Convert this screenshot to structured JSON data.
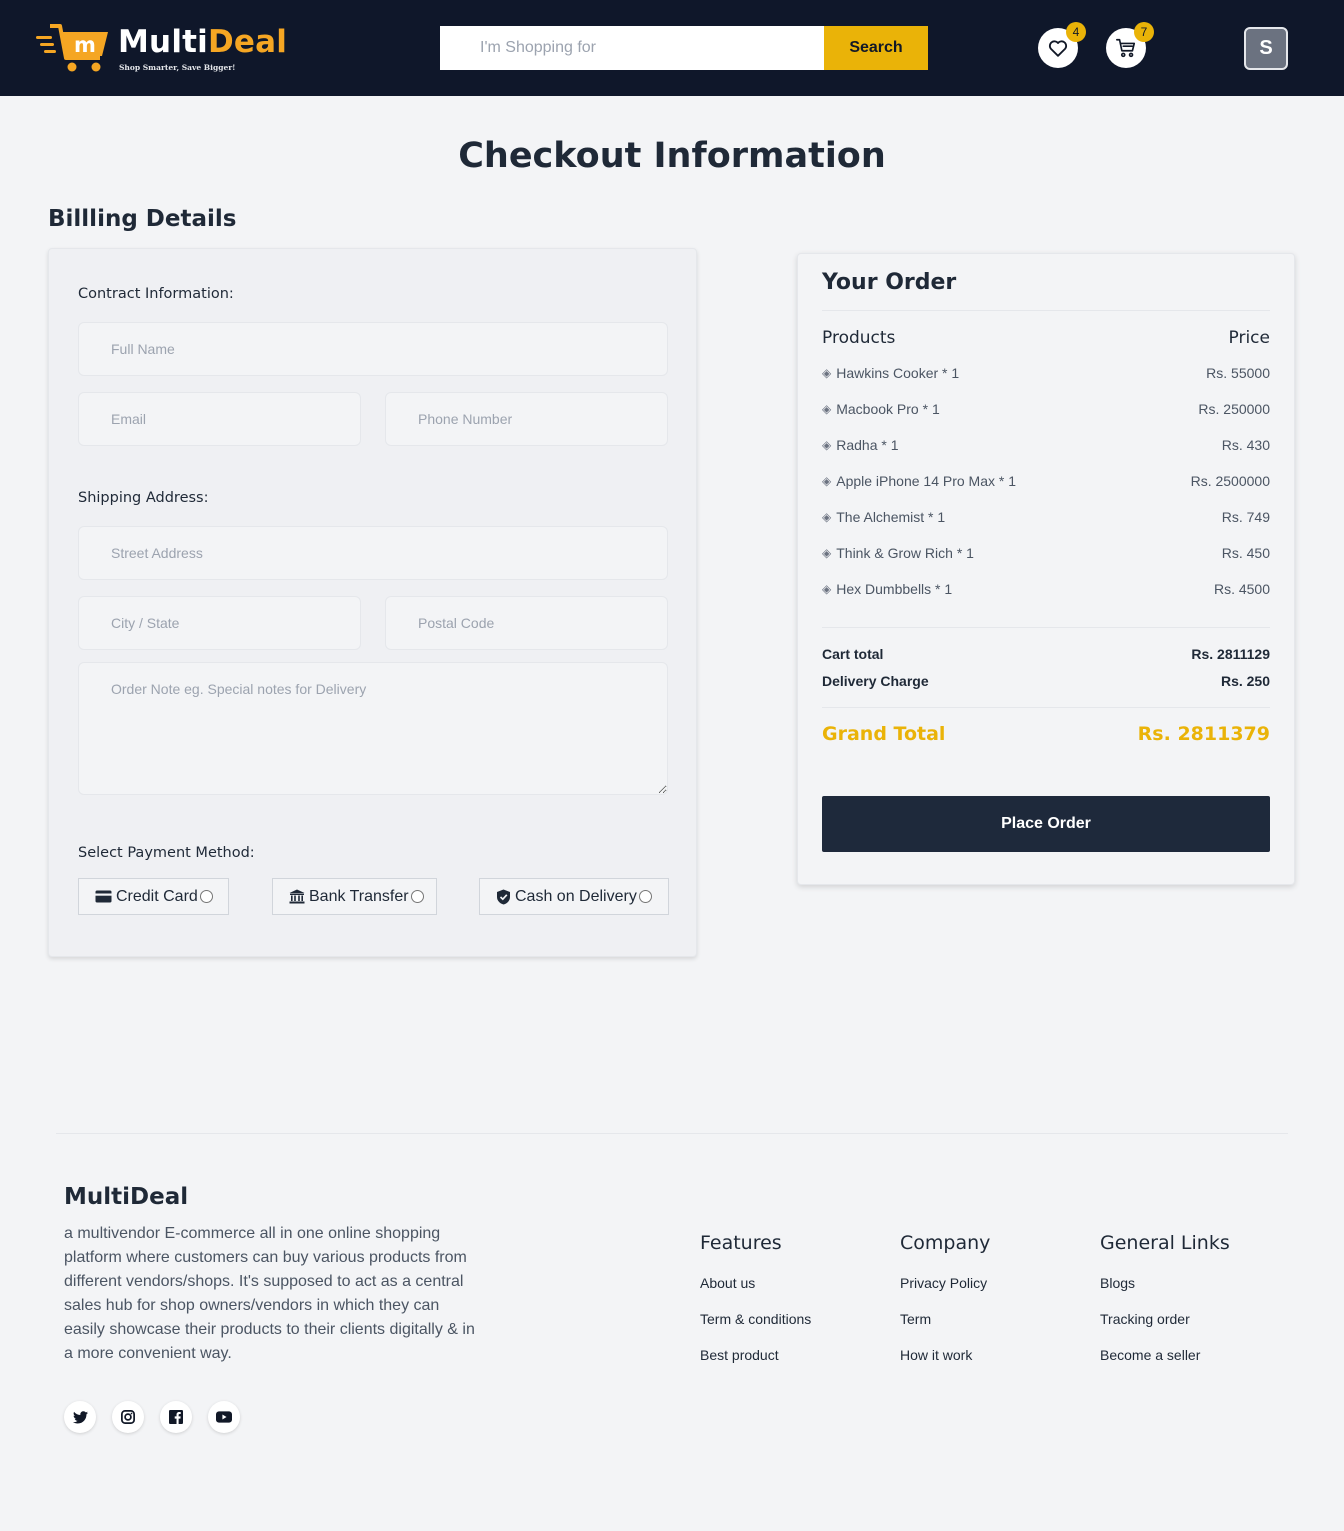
{
  "header": {
    "logo_part1": "Multi",
    "logo_part2": "Deal",
    "logo_tagline": "Shop Smarter, Save Bigger!",
    "search_placeholder": "I'm Shopping for",
    "search_button": "Search",
    "wishlist_count": "4",
    "cart_count": "7",
    "avatar_initial": "S",
    "colors": {
      "bar": "#0f172a",
      "accent": "#eab308",
      "logo_orange": "#f5a623"
    }
  },
  "page": {
    "title": "Checkout Information",
    "billing_title": "Billling Details"
  },
  "billing": {
    "contact_label": "Contract Information:",
    "full_name_placeholder": "Full Name",
    "email_placeholder": "Email",
    "phone_placeholder": "Phone Number",
    "shipping_label": "Shipping Address:",
    "street_placeholder": "Street Address",
    "city_placeholder": "City / State",
    "postal_placeholder": "Postal Code",
    "note_placeholder": "Order Note eg. Special notes for Delivery",
    "payment_label": "Select Payment Method:",
    "payment_options": [
      {
        "label": "Credit Card",
        "icon": "credit-card-icon"
      },
      {
        "label": "Bank Transfer",
        "icon": "bank-icon"
      },
      {
        "label": "Cash on Delivery",
        "icon": "shield-check-icon"
      }
    ]
  },
  "order": {
    "title": "Your Order",
    "products_header": "Products",
    "price_header": "Price",
    "items": [
      {
        "name": "Hawkins Cooker * 1",
        "price": "Rs. 55000"
      },
      {
        "name": "Macbook Pro * 1",
        "price": "Rs. 250000"
      },
      {
        "name": "Radha * 1",
        "price": "Rs. 430"
      },
      {
        "name": "Apple iPhone 14 Pro Max * 1",
        "price": "Rs. 2500000"
      },
      {
        "name": "The Alchemist * 1",
        "price": "Rs. 749"
      },
      {
        "name": "Think & Grow Rich * 1",
        "price": "Rs. 450"
      },
      {
        "name": "Hex Dumbbells * 1",
        "price": "Rs. 4500"
      }
    ],
    "cart_total_label": "Cart total",
    "cart_total": "Rs. 2811129",
    "delivery_label": "Delivery Charge",
    "delivery": "Rs. 250",
    "grand_total_label": "Grand Total",
    "grand_total": "Rs. 2811379",
    "place_order": "Place Order"
  },
  "footer": {
    "brand": "MultiDeal",
    "description": "a multivendor E-commerce all in one online shopping platform where customers can buy various products from different vendors/shops. It's supposed to act as a central sales hub for shop owners/vendors in which they can easily showcase their products to their clients digitally & in a more convenient way.",
    "social": [
      "twitter-icon",
      "instagram-icon",
      "facebook-icon",
      "youtube-icon"
    ],
    "columns": [
      {
        "title": "Features",
        "links": [
          "About us",
          "Term & conditions",
          "Best product"
        ]
      },
      {
        "title": "Company",
        "links": [
          "Privacy Policy",
          "Term",
          "How it work"
        ]
      },
      {
        "title": "General Links",
        "links": [
          "Blogs",
          "Tracking order",
          "Become a seller"
        ]
      }
    ]
  }
}
